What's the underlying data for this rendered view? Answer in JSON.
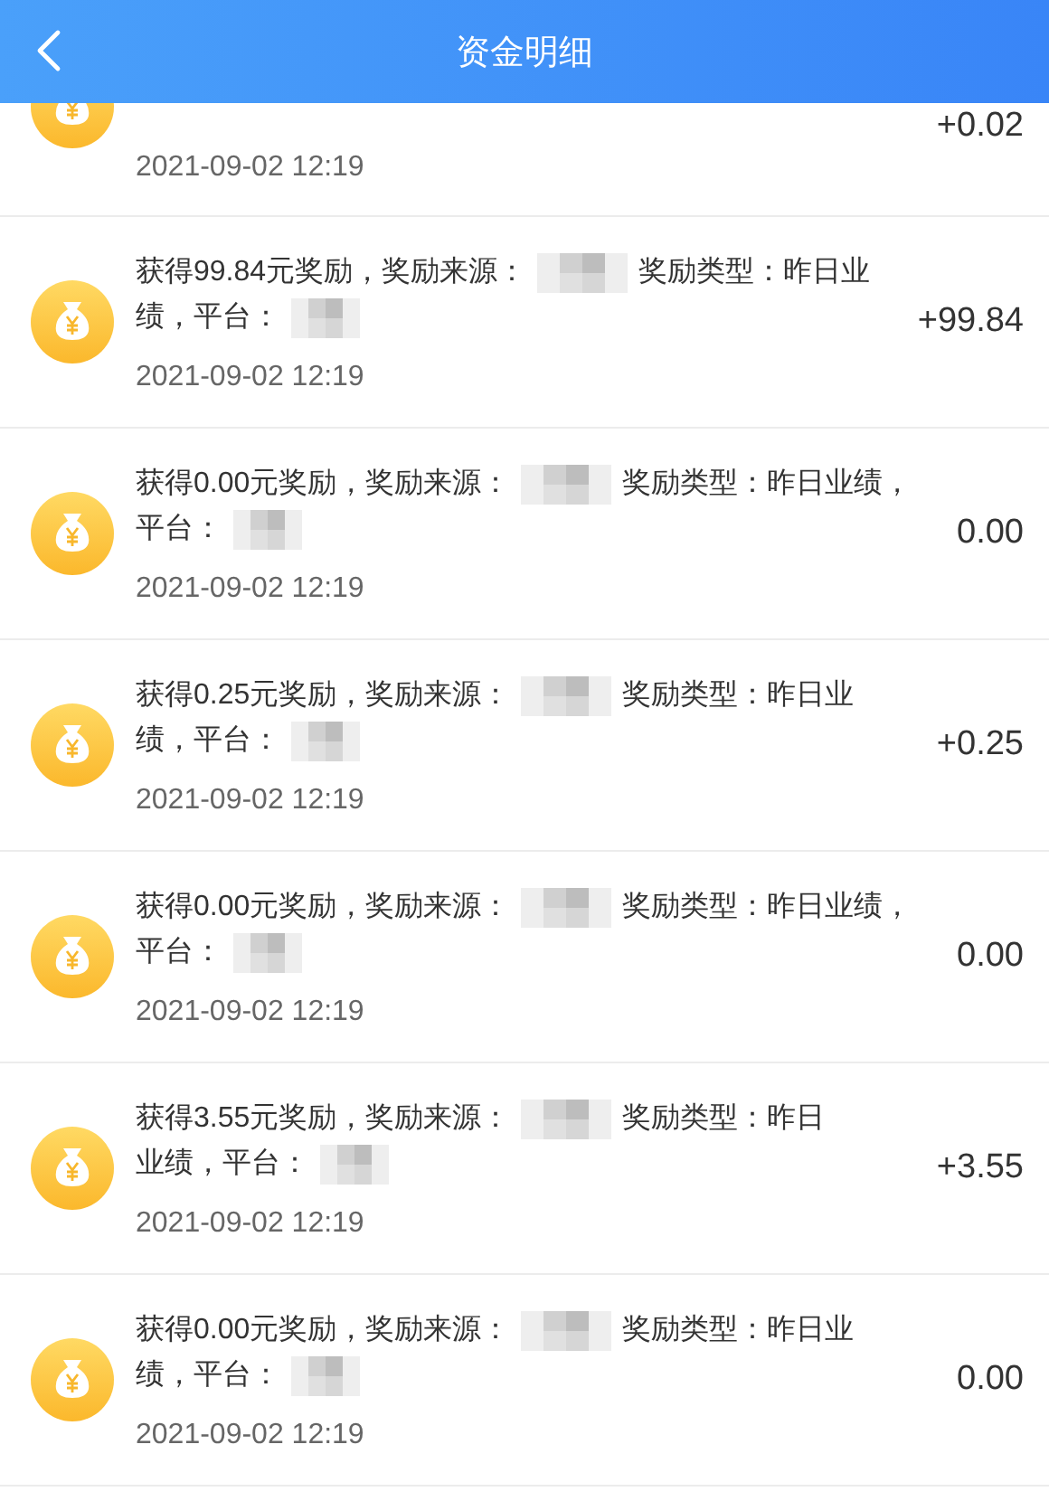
{
  "header": {
    "title": "资金明细"
  },
  "records": [
    {
      "kind": "partial",
      "date": "2021-09-02 12:19",
      "amount": "+0.02"
    },
    {
      "kind": "full",
      "desc": [
        {
          "kind": "text",
          "text": "获得99.84元奖励，奖励来源："
        },
        {
          "kind": "redacted"
        },
        {
          "kind": "text",
          "text": "奖励类型：昨日业"
        },
        {
          "kind": "text",
          "text": "绩，平台："
        },
        {
          "kind": "redacted"
        }
      ],
      "date": "2021-09-02 12:19",
      "amount": "+99.84"
    },
    {
      "kind": "full",
      "desc": [
        {
          "kind": "text",
          "text": "获得0.00元奖励，奖励来源："
        },
        {
          "kind": "redacted"
        },
        {
          "kind": "text",
          "text": "奖励类型：昨日业绩，"
        },
        {
          "kind": "text",
          "text": "平台："
        },
        {
          "kind": "redacted"
        }
      ],
      "date": "2021-09-02 12:19",
      "amount": "0.00"
    },
    {
      "kind": "full",
      "desc": [
        {
          "kind": "text",
          "text": "获得0.25元奖励，奖励来源："
        },
        {
          "kind": "redacted"
        },
        {
          "kind": "text",
          "text": "奖励类型：昨日业"
        },
        {
          "kind": "text",
          "text": "绩，平台："
        },
        {
          "kind": "redacted"
        }
      ],
      "date": "2021-09-02 12:19",
      "amount": "+0.25"
    },
    {
      "kind": "full",
      "desc": [
        {
          "kind": "text",
          "text": "获得0.00元奖励，奖励来源："
        },
        {
          "kind": "redacted"
        },
        {
          "kind": "text",
          "text": "奖励类型：昨日业绩，"
        },
        {
          "kind": "text",
          "text": "平台："
        },
        {
          "kind": "redacted"
        }
      ],
      "date": "2021-09-02 12:19",
      "amount": "0.00"
    },
    {
      "kind": "full",
      "desc": [
        {
          "kind": "text",
          "text": "获得3.55元奖励，奖励来源："
        },
        {
          "kind": "redacted"
        },
        {
          "kind": "text",
          "text": "奖励类型：昨日"
        },
        {
          "kind": "text",
          "text": "业绩，平台："
        },
        {
          "kind": "redacted"
        }
      ],
      "date": "2021-09-02 12:19",
      "amount": "+3.55"
    },
    {
      "kind": "full",
      "desc": [
        {
          "kind": "text",
          "text": "获得0.00元奖励，奖励来源："
        },
        {
          "kind": "redacted"
        },
        {
          "kind": "text",
          "text": "奖励类型：昨日业"
        },
        {
          "kind": "text",
          "text": "绩，平台："
        },
        {
          "kind": "redacted"
        }
      ],
      "date": "2021-09-02 12:19",
      "amount": "0.00"
    }
  ]
}
